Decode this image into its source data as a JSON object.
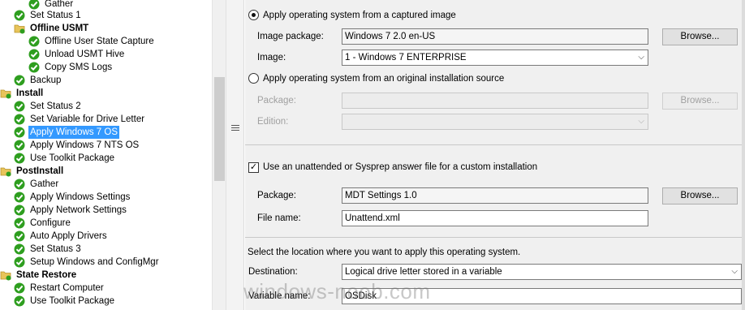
{
  "tree": {
    "items": [
      {
        "label": "Gather",
        "icon": "check-icon"
      },
      {
        "label": "Set Status 1",
        "icon": "check-icon"
      },
      {
        "label": "Offline USMT",
        "icon": "folder-icon"
      },
      {
        "label": "Offline User State Capture",
        "icon": "check-icon"
      },
      {
        "label": "Unload USMT Hive",
        "icon": "check-icon"
      },
      {
        "label": "Copy SMS Logs",
        "icon": "check-icon"
      },
      {
        "label": "Backup",
        "icon": "check-icon"
      },
      {
        "label": "Install",
        "icon": "folder-icon"
      },
      {
        "label": "Set Status 2",
        "icon": "check-icon"
      },
      {
        "label": "Set Variable for Drive Letter",
        "icon": "check-icon"
      },
      {
        "label": "Apply Windows 7 OS",
        "icon": "check-icon"
      },
      {
        "label": "Apply Windows 7 NTS OS",
        "icon": "check-icon"
      },
      {
        "label": "Use Toolkit Package",
        "icon": "check-icon"
      },
      {
        "label": "PostInstall",
        "icon": "folder-icon"
      },
      {
        "label": "Gather",
        "icon": "check-icon"
      },
      {
        "label": "Apply Windows Settings",
        "icon": "check-icon"
      },
      {
        "label": "Apply Network Settings",
        "icon": "check-icon"
      },
      {
        "label": "Configure",
        "icon": "check-icon"
      },
      {
        "label": "Auto Apply Drivers",
        "icon": "check-icon"
      },
      {
        "label": "Set Status 3",
        "icon": "check-icon"
      },
      {
        "label": "Setup Windows and ConfigMgr",
        "icon": "check-icon"
      },
      {
        "label": "State Restore",
        "icon": "folder-icon"
      },
      {
        "label": "Restart Computer",
        "icon": "check-icon"
      },
      {
        "label": "Use Toolkit Package",
        "icon": "check-icon"
      }
    ],
    "selected": "Apply Windows 7 OS"
  },
  "panel": {
    "radio_captured": "Apply operating system from a captured image",
    "image_package_label": "Image package:",
    "image_package_value": "Windows 7 2.0 en-US",
    "browse_label": "Browse...",
    "image_label": "Image:",
    "image_value": "1 - Windows 7 ENTERPRISE",
    "radio_source": "Apply operating system from an original installation source",
    "package_label": "Package:",
    "edition_label": "Edition:",
    "unattend_check": "Use an unattended or Sysprep answer file for a custom installation",
    "answer_package_label": "Package:",
    "answer_package_value": "MDT Settings 1.0",
    "file_name_label": "File name:",
    "file_name_value": "Unattend.xml",
    "location_text": "Select the location where you want to apply this operating system.",
    "destination_label": "Destination:",
    "destination_value": "Logical drive letter stored in a variable",
    "variable_name_label": "Variable name:",
    "variable_name_value": "OSDisk"
  },
  "watermark": "windows-noob.com",
  "colors": {
    "selection": "#3399ff",
    "check_green": "#2e9e1f",
    "folder_yellow": "#e8c45a"
  }
}
